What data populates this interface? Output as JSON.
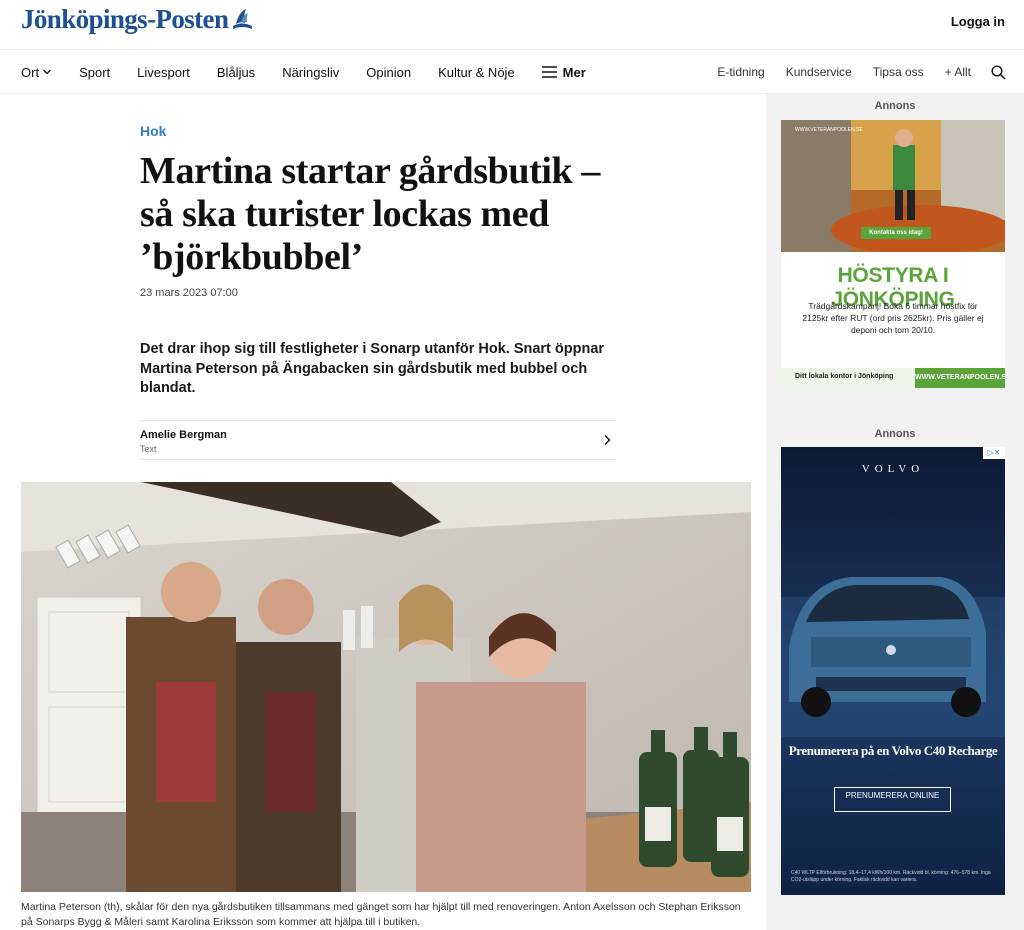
{
  "site": {
    "logo_text": "Jönköpings-Posten",
    "login_label": "Logga in"
  },
  "nav": {
    "left": [
      "Ort",
      "Sport",
      "Livesport",
      "Blåljus",
      "Näringsliv",
      "Opinion",
      "Kultur & Nöje"
    ],
    "more_label": "Mer",
    "right": [
      "E-tidning",
      "Kundservice",
      "Tipsa oss",
      "+ Allt"
    ]
  },
  "article": {
    "kicker": "Hok",
    "headline": "Martina startar gårdsbutik – så ska turister lockas med ’björkbubbel’",
    "date": "23 mars 2023 07:00",
    "lead": "Det drar ihop sig till festligheter i Sonarp utanför Hok. Snart öppnar Martina Peterson på Ängabacken sin gårdsbutik med bubbel och blandat.",
    "author_name": "Amelie Bergman",
    "author_role": "Text",
    "caption": "Martina Peterson (th), skålar för den nya gårdsbutiken tillsammans med  gänget som har hjälpt till med renoveringen. Anton Axelsson och Stephan Eriksson på Sonarps Bygg & Måleri samt Karolina Eriksson som kommer att hjälpa till i butiken."
  },
  "sidebar": {
    "ad_label": "Annons",
    "ad1": {
      "url_top": "WWW.VETERANPOOLEN.SE",
      "cta": "Kontakta oss idag!",
      "title": "HÖSTYRA I JÖNKÖPING",
      "body": "Trädgårdskampanj! Boka 6 timmar höstfix för 2125kr efter RUT (ord pris 2625kr). Pris gäller ej deponi och tom 20/10.",
      "footer_left": "Ditt lokala kontor i Jönköping",
      "footer_right": "WWW.VETERANPOOLEN.SE"
    },
    "ad2": {
      "brand": "VOLVO",
      "adchoice": "▷✕",
      "headline": "Prenumerera på en Volvo C40 Recharge",
      "button": "PRENUMERERA ONLINE",
      "fine_print": "C40 WLTP Elförbrukning: 18,4–17,4 kWh/100 km. Räckvidd bl. körning: 476–578 km. Inga CO2-utsläpp under körning. Faktisk räckvidd kan variera."
    }
  },
  "colors": {
    "brand_blue": "#1d4f91",
    "kicker_blue": "#2f7fc1",
    "ad_green": "#5aa43a"
  }
}
